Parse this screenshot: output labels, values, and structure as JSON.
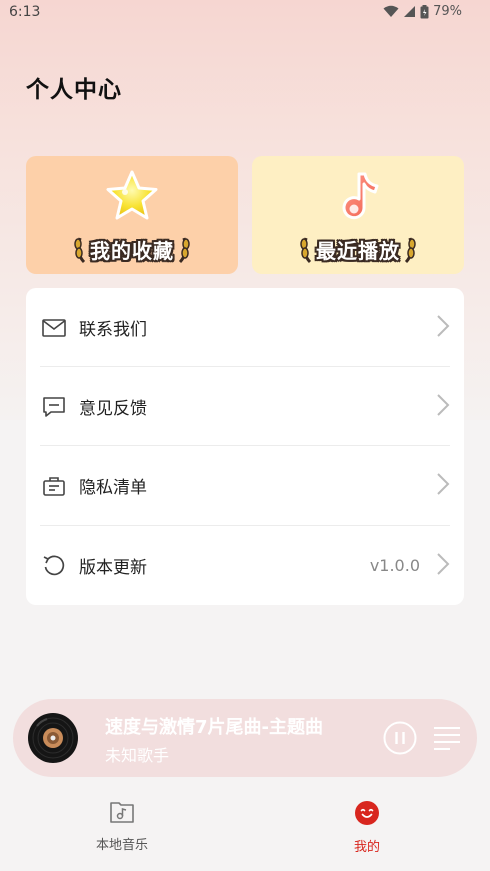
{
  "status": {
    "time": "6:13",
    "battery": "79%"
  },
  "page": {
    "title": "个人中心"
  },
  "cards": [
    {
      "label": "我的收藏",
      "icon": "star-icon"
    },
    {
      "label": "最近播放",
      "icon": "music-note-icon"
    }
  ],
  "menu": {
    "items": [
      {
        "label": "联系我们",
        "icon": "mail-icon"
      },
      {
        "label": "意见反馈",
        "icon": "feedback-icon"
      },
      {
        "label": "隐私清单",
        "icon": "privacy-list-icon"
      },
      {
        "label": "版本更新",
        "icon": "refresh-icon",
        "value": "v1.0.0"
      }
    ]
  },
  "player": {
    "title": "速度与激情7片尾曲-主题曲",
    "artist": "未知歌手",
    "state": "playing"
  },
  "nav": {
    "items": [
      {
        "label": "本地音乐",
        "icon": "folder-music-icon",
        "active": false
      },
      {
        "label": "我的",
        "icon": "smile-face-icon",
        "active": true
      }
    ]
  },
  "colors": {
    "accent": "#d8261e",
    "favorite_card": "#fdd0a9",
    "recent_card": "#feefc3",
    "player_bg": "#f2dede"
  }
}
